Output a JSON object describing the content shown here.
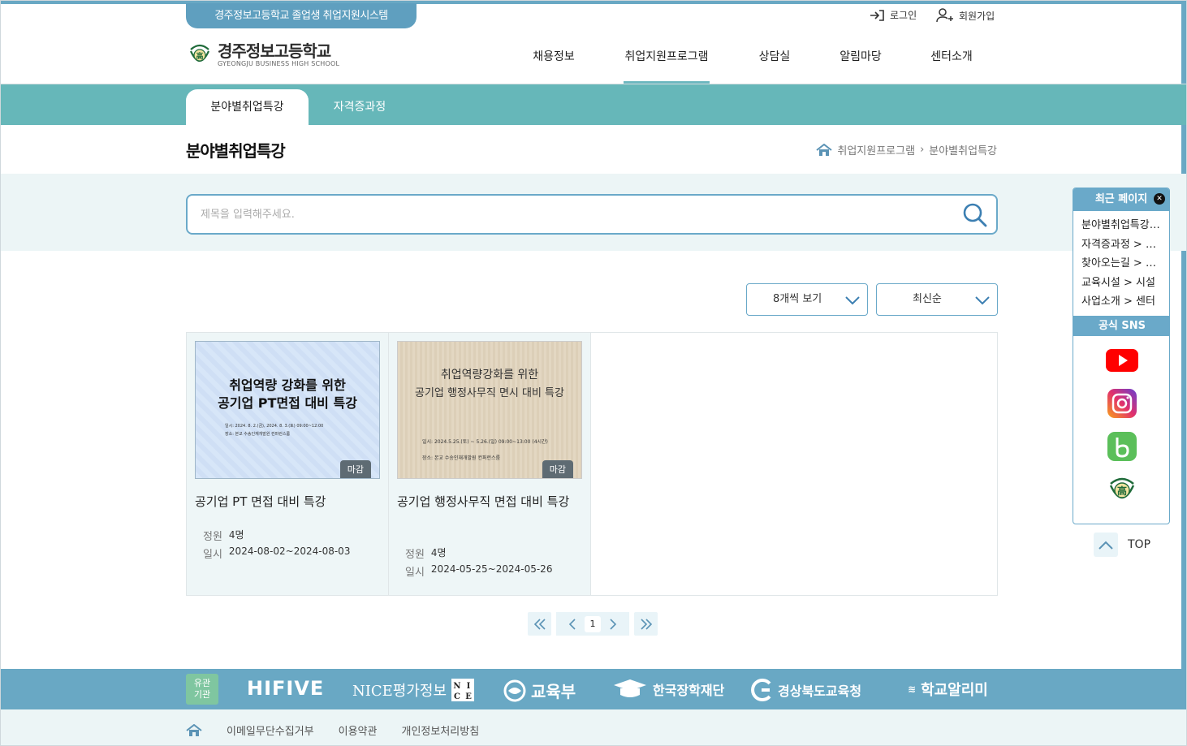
{
  "header": {
    "system_badge": "경주정보고등학교 졸업생 취업지원시스템",
    "login": "로그인",
    "signup": "회원가입",
    "logo_title": "경주정보고등학교",
    "logo_sub": "GYEONGJU BUSINESS HIGH SCHOOL",
    "nav": [
      "채용정보",
      "취업지원프로그램",
      "상담실",
      "알림마당",
      "센터소개"
    ]
  },
  "subtabs": [
    "분야별취업특강",
    "자격증과정"
  ],
  "page": {
    "title": "분야별취업특강",
    "breadcrumb": [
      "취업지원프로그램",
      "분야별취업특강"
    ]
  },
  "search": {
    "placeholder": "제목을 입력해주세요."
  },
  "filters": {
    "per_page": "8개씩 보기",
    "sort": "최신순"
  },
  "cards": [
    {
      "thumb_line1": "취업역량 강화를 위한",
      "thumb_line2": "공기업 PT면접 대비 특강",
      "thumb_small1": "일시: 2024. 8. 2.(금), 2024. 8. 3.(토) 09:00~12:00",
      "thumb_small2": "장소: 본교 수송인재개발원 컨퍼런스룸",
      "badge": "마감",
      "title": "공기업 PT 면접 대비 특강",
      "capacity_label": "정원",
      "capacity": "4명",
      "date_label": "일시",
      "date": "2024-08-02~2024-08-03"
    },
    {
      "thumb_line1": "취업역량강화를 위한",
      "thumb_line2": "공기업 행정사무직 면시 대비 특강",
      "thumb_small1": "일시: 2024.5.25.(토) ~ 5.26.(일) 09:00~13:00 (4시간)",
      "thumb_small2": "장소: 본교 수송인재개발원 컨퍼런스룸",
      "badge": "마감",
      "title": "공기업 행정사무직 면접 대비 특강",
      "capacity_label": "정원",
      "capacity": "4명",
      "date_label": "일시",
      "date": "2024-05-25~2024-05-26"
    }
  ],
  "pagination": {
    "current": "1"
  },
  "quick": {
    "recent_title": "최근 페이지",
    "recent": [
      "분야별취업특강 > 분야별취업특강",
      "자격증과정 > 자격증과정",
      "찾아오는길 > 찾아오는길",
      "교육시설 > 시설",
      "사업소개 > 센터"
    ],
    "sns_title": "공식 SNS",
    "top": "TOP"
  },
  "footer": {
    "partner_label_1": "유관",
    "partner_label_2": "기관",
    "partners": [
      "HIFIVE",
      "NICE평가정보",
      "교육부",
      "한국장학재단",
      "경상북도교육청",
      "학교알리미"
    ],
    "links": [
      "이메일무단수집거부",
      "이용약관",
      "개인정보처리방침"
    ]
  }
}
